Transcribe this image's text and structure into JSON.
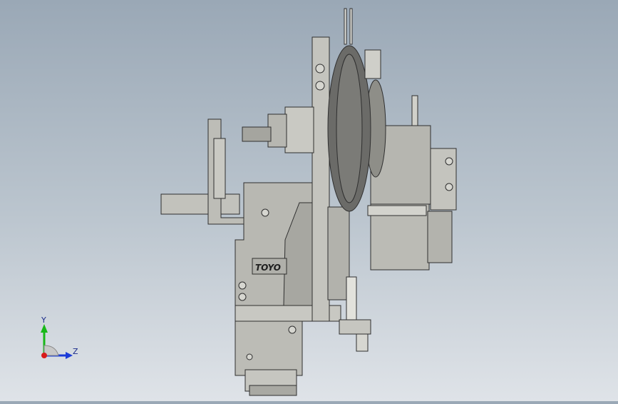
{
  "model": {
    "logo_text": "TOYO"
  },
  "triad": {
    "y_label": "Y",
    "z_label": "Z",
    "colors": {
      "y": "#18b818",
      "z": "#1b3cd8",
      "x": "#d81b1b"
    }
  },
  "palette": {
    "metal": "#b4b4ae",
    "metal_light": "#cdcdc7",
    "metal_dark": "#8e8e88",
    "edge": "#2f2f2f",
    "wheel": "#6b6b68"
  }
}
